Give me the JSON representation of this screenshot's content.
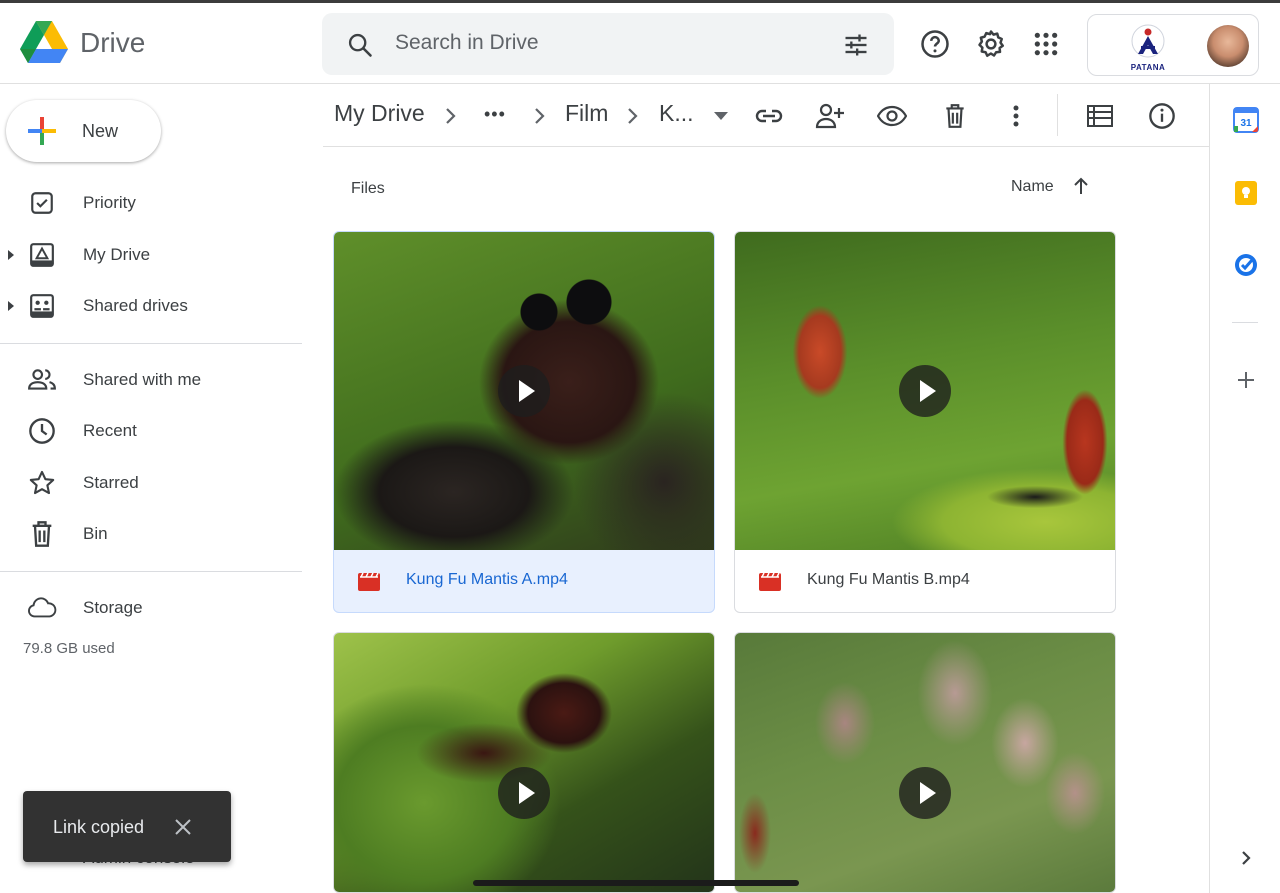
{
  "app": {
    "name": "Drive"
  },
  "search": {
    "placeholder": "Search in Drive"
  },
  "account": {
    "org_logo_text": "PATANA"
  },
  "new_button": {
    "label": "New"
  },
  "sidebar": {
    "items": [
      {
        "label": "Priority",
        "icon": "priority-icon"
      },
      {
        "label": "My Drive",
        "icon": "my-drive-icon"
      },
      {
        "label": "Shared drives",
        "icon": "shared-drives-icon"
      },
      {
        "label": "Shared with me",
        "icon": "people-icon"
      },
      {
        "label": "Recent",
        "icon": "clock-icon"
      },
      {
        "label": "Starred",
        "icon": "star-icon"
      },
      {
        "label": "Bin",
        "icon": "bin-icon"
      },
      {
        "label": "Storage",
        "icon": "cloud-icon"
      }
    ],
    "storage_used": "79.8 GB used",
    "hidden_item": "Admin console"
  },
  "breadcrumb": {
    "root": "My Drive",
    "ellipsis": "•••",
    "folder": "Film",
    "current": "K..."
  },
  "content": {
    "section_label": "Files",
    "sort_label": "Name"
  },
  "files": [
    {
      "name": "Kung Fu Mantis A.mp4",
      "selected": true
    },
    {
      "name": "Kung Fu Mantis B.mp4",
      "selected": false
    },
    {
      "name": "",
      "selected": false
    },
    {
      "name": "",
      "selected": false
    }
  ],
  "right_panel": {
    "calendar_day": "31"
  },
  "toast": {
    "message": "Link copied"
  },
  "colors": {
    "accent": "#1967d2",
    "selected_bg": "#e8f0fe",
    "toast_bg": "#323232"
  }
}
